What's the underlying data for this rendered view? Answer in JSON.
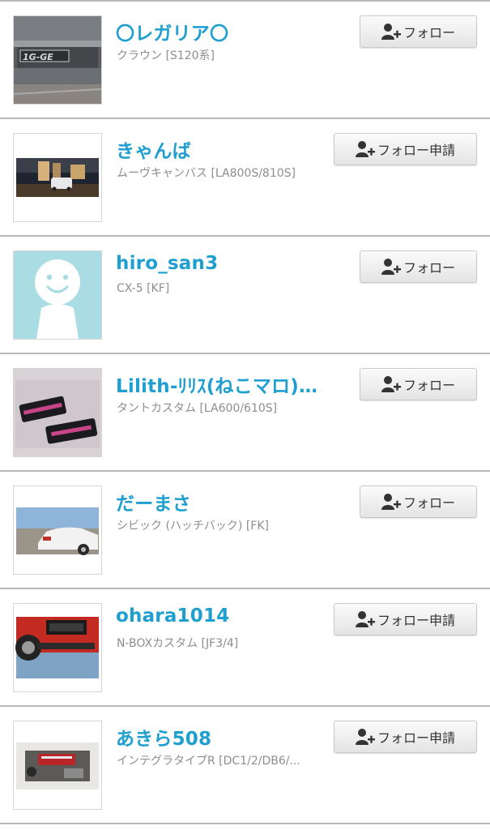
{
  "colors": {
    "name": "#1e9fd0",
    "car": "#8e8e8e",
    "divider": "#b8b8b8"
  },
  "users": [
    {
      "name": "〇レガリア〇",
      "car": "クラウン [S120系]",
      "button": "フォロー",
      "thumb": "engine-cover-photo"
    },
    {
      "name": "きゃんば",
      "car": "ムーヴキャンバス [LA800S/810S]",
      "button": "フォロー申請",
      "thumb": "night-street-car-photo"
    },
    {
      "name": "hiro_san3",
      "car": "CX-5 [KF]",
      "button": "フォロー",
      "thumb": "default-avatar"
    },
    {
      "name": "Lilith-ﾘﾘｽ(ねこマロ)ほ...",
      "car": "タントカスタム [LA600/610S]",
      "button": "フォロー",
      "thumb": "sticker-photo"
    },
    {
      "name": "だーまさ",
      "car": "シビック (ハッチバック) [FK]",
      "button": "フォロー",
      "thumb": "white-car-photo"
    },
    {
      "name": "ohara1014",
      "car": "N-BOXカスタム [JF3/4]",
      "button": "フォロー申請",
      "thumb": "red-bumper-photo"
    },
    {
      "name": "あきら508",
      "car": "インテグラタイプR [DC1/2/DB6/...",
      "button": "フォロー申請",
      "thumb": "engine-bay-photo"
    }
  ]
}
